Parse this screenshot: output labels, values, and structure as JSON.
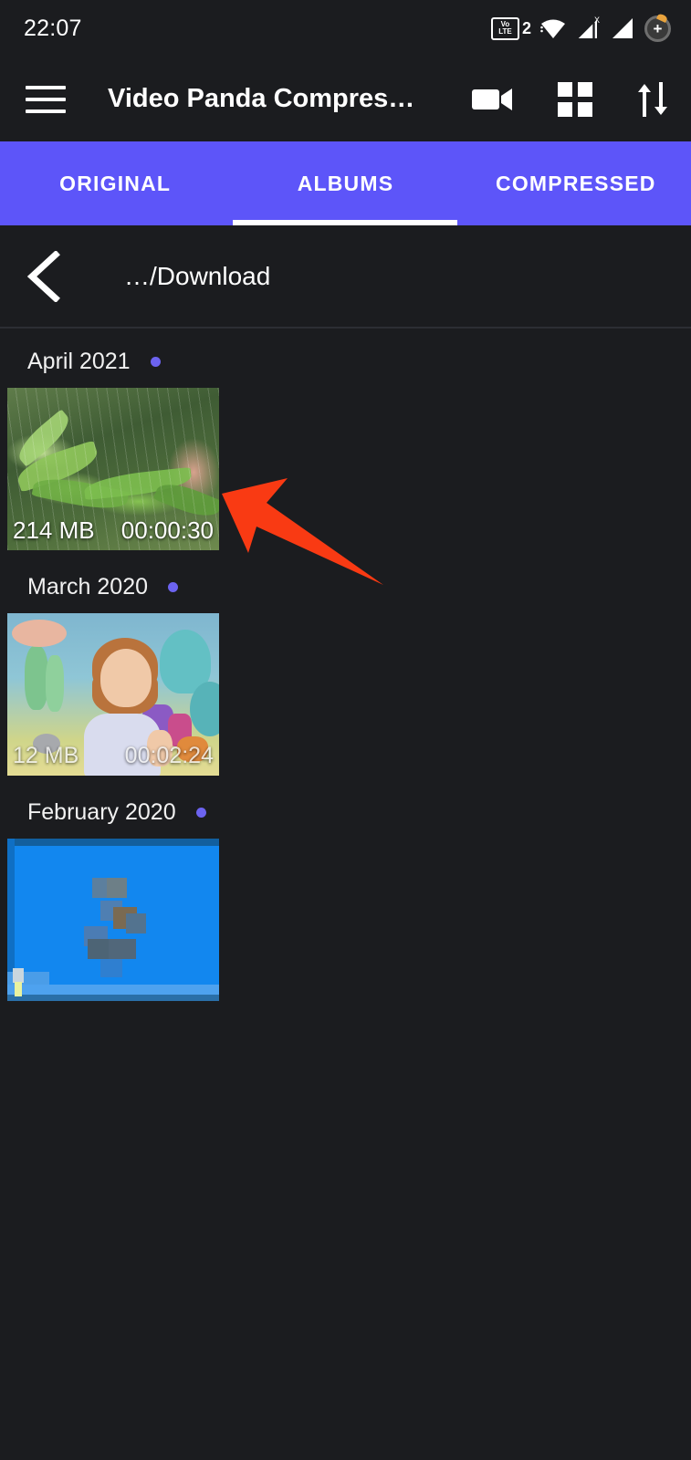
{
  "status_bar": {
    "clock": "22:07",
    "icons": [
      {
        "name": "volte-icon",
        "label_top": "Vo",
        "label_bottom": "LTE",
        "sim": "2"
      },
      {
        "name": "wifi-icon",
        "label": "wifi"
      },
      {
        "name": "signal-no-service-icon",
        "label": "X"
      },
      {
        "name": "signal-bars-icon",
        "label": "signal"
      },
      {
        "name": "battery-charging-icon",
        "label": "+"
      }
    ]
  },
  "app_bar": {
    "menu_icon": "hamburger-menu-icon",
    "title": "Video Panda Compres…",
    "actions": [
      {
        "name": "video-camera-icon",
        "label": "Record video"
      },
      {
        "name": "grid-view-icon",
        "label": "Grid view"
      },
      {
        "name": "sort-icon",
        "label": "Sort"
      }
    ]
  },
  "tabs": {
    "items": [
      {
        "label": "ORIGINAL",
        "active": false
      },
      {
        "label": "ALBUMS",
        "active": true
      },
      {
        "label": "COMPRESSED",
        "active": false
      }
    ],
    "active_index": 1
  },
  "breadcrumb": {
    "back_icon": "back-chevron-icon",
    "path": "…/Download"
  },
  "groups": [
    {
      "title": "April 2021",
      "dot_color": "#6c63f0",
      "videos": [
        {
          "size": "214 MB",
          "duration": "00:00:30",
          "thumb": "rain-leaves"
        }
      ]
    },
    {
      "title": "March 2020",
      "dot_color": "#6c63f0",
      "videos": [
        {
          "size": "12 MB",
          "duration": "00:02:24",
          "thumb": "cartoon-underwater"
        }
      ]
    },
    {
      "title": "February 2020",
      "dot_color": "#6c63f0",
      "videos": [
        {
          "size": "",
          "duration": "",
          "thumb": "blue-pixelated"
        }
      ]
    }
  ],
  "annotation": {
    "arrow_color": "#f93a13",
    "name": "red-pointer-arrow",
    "points_to": "April 2021 video thumbnail"
  },
  "colors": {
    "background": "#1b1c1f",
    "tab_bar": "#5d55f9",
    "accent_dot": "#6c63f0",
    "text_primary": "#ffffff",
    "divider": "#2c2e33"
  }
}
